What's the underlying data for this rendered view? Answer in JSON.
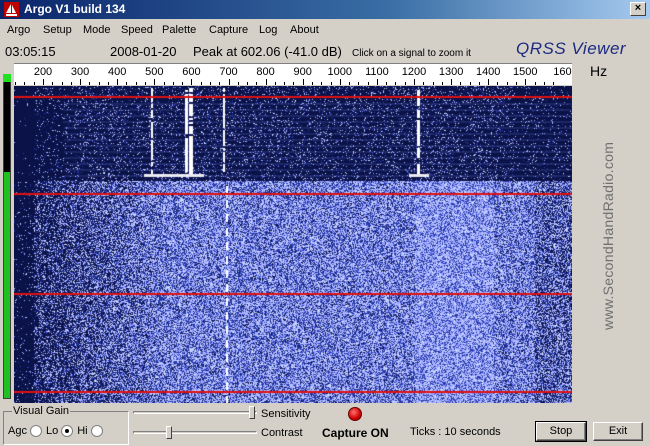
{
  "window": {
    "title": "Argo V1 build 134",
    "close_glyph": "×",
    "icon": "argo-sailboat-icon"
  },
  "menu": [
    "Argo",
    "Setup",
    "Mode",
    "Speed",
    "Palette",
    "Capture",
    "Log",
    "About"
  ],
  "status": {
    "time": "03:05:15",
    "date": "2008-01-20",
    "peak": "Peak at 602.06 (-41.0 dB)",
    "hint": "Click on a signal to zoom it",
    "view_title": "QRSS Viewer"
  },
  "frequency_axis": {
    "unit": "Hz",
    "ticks": [
      "200",
      "300",
      "400",
      "500",
      "600",
      "700",
      "800",
      "900",
      "1000",
      "1100",
      "1200",
      "1300",
      "1400",
      "1500",
      "160"
    ]
  },
  "waterfall": {
    "watermark": "www.SecondHandRadio.com"
  },
  "controls": {
    "visual_gain_label": "Visual Gain",
    "agc_label": "Agc",
    "lo_label": "Lo",
    "hi_label": "Hi",
    "selected_gain": "Lo",
    "sensitivity_label": "Sensitivity",
    "contrast_label": "Contrast",
    "capture_status": "Capture ON",
    "ticks_text": "Ticks   : 10 seconds",
    "stop_label": "Stop",
    "exit_label": "Exit",
    "capture_color": "#d00000"
  },
  "colors": {
    "background_blue": "#0a1248",
    "noise": "#dfe6ff",
    "marker_red": "#e01010",
    "titlebar": "#0a246a"
  }
}
